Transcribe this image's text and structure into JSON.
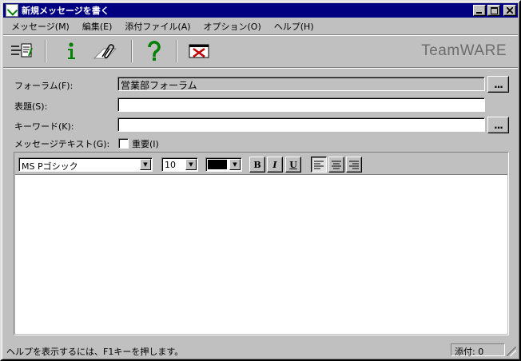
{
  "window": {
    "title": "新規メッセージを書く"
  },
  "menu": [
    {
      "label": "メッセージ(M)"
    },
    {
      "label": "編集(E)"
    },
    {
      "label": "添付ファイル(A)"
    },
    {
      "label": "オプション(O)"
    },
    {
      "label": "ヘルプ(H)"
    }
  ],
  "toolbar": {
    "brand": "TeamWARE",
    "icons": [
      "send-icon",
      "info-icon",
      "attach-icon",
      "help-icon",
      "close-message-icon"
    ]
  },
  "form": {
    "forum_label": "フォーラム(F):",
    "forum_value": "営業部フォーラム",
    "subject_label": "表題(S):",
    "subject_value": "",
    "keyword_label": "キーワード(K):",
    "keyword_value": "",
    "text_label": "メッセージテキスト(G):",
    "important_label": "重要(I)",
    "important_checked": false,
    "dots_label": "..."
  },
  "format": {
    "font": "MS Pゴシック",
    "size": "10",
    "color": "#000000",
    "bold": "B",
    "italic": "I",
    "underline": "U",
    "align_selected": "left"
  },
  "status": {
    "message": "ヘルプを表示するには、F1キーを押します。",
    "attachments": "添付: 0"
  }
}
